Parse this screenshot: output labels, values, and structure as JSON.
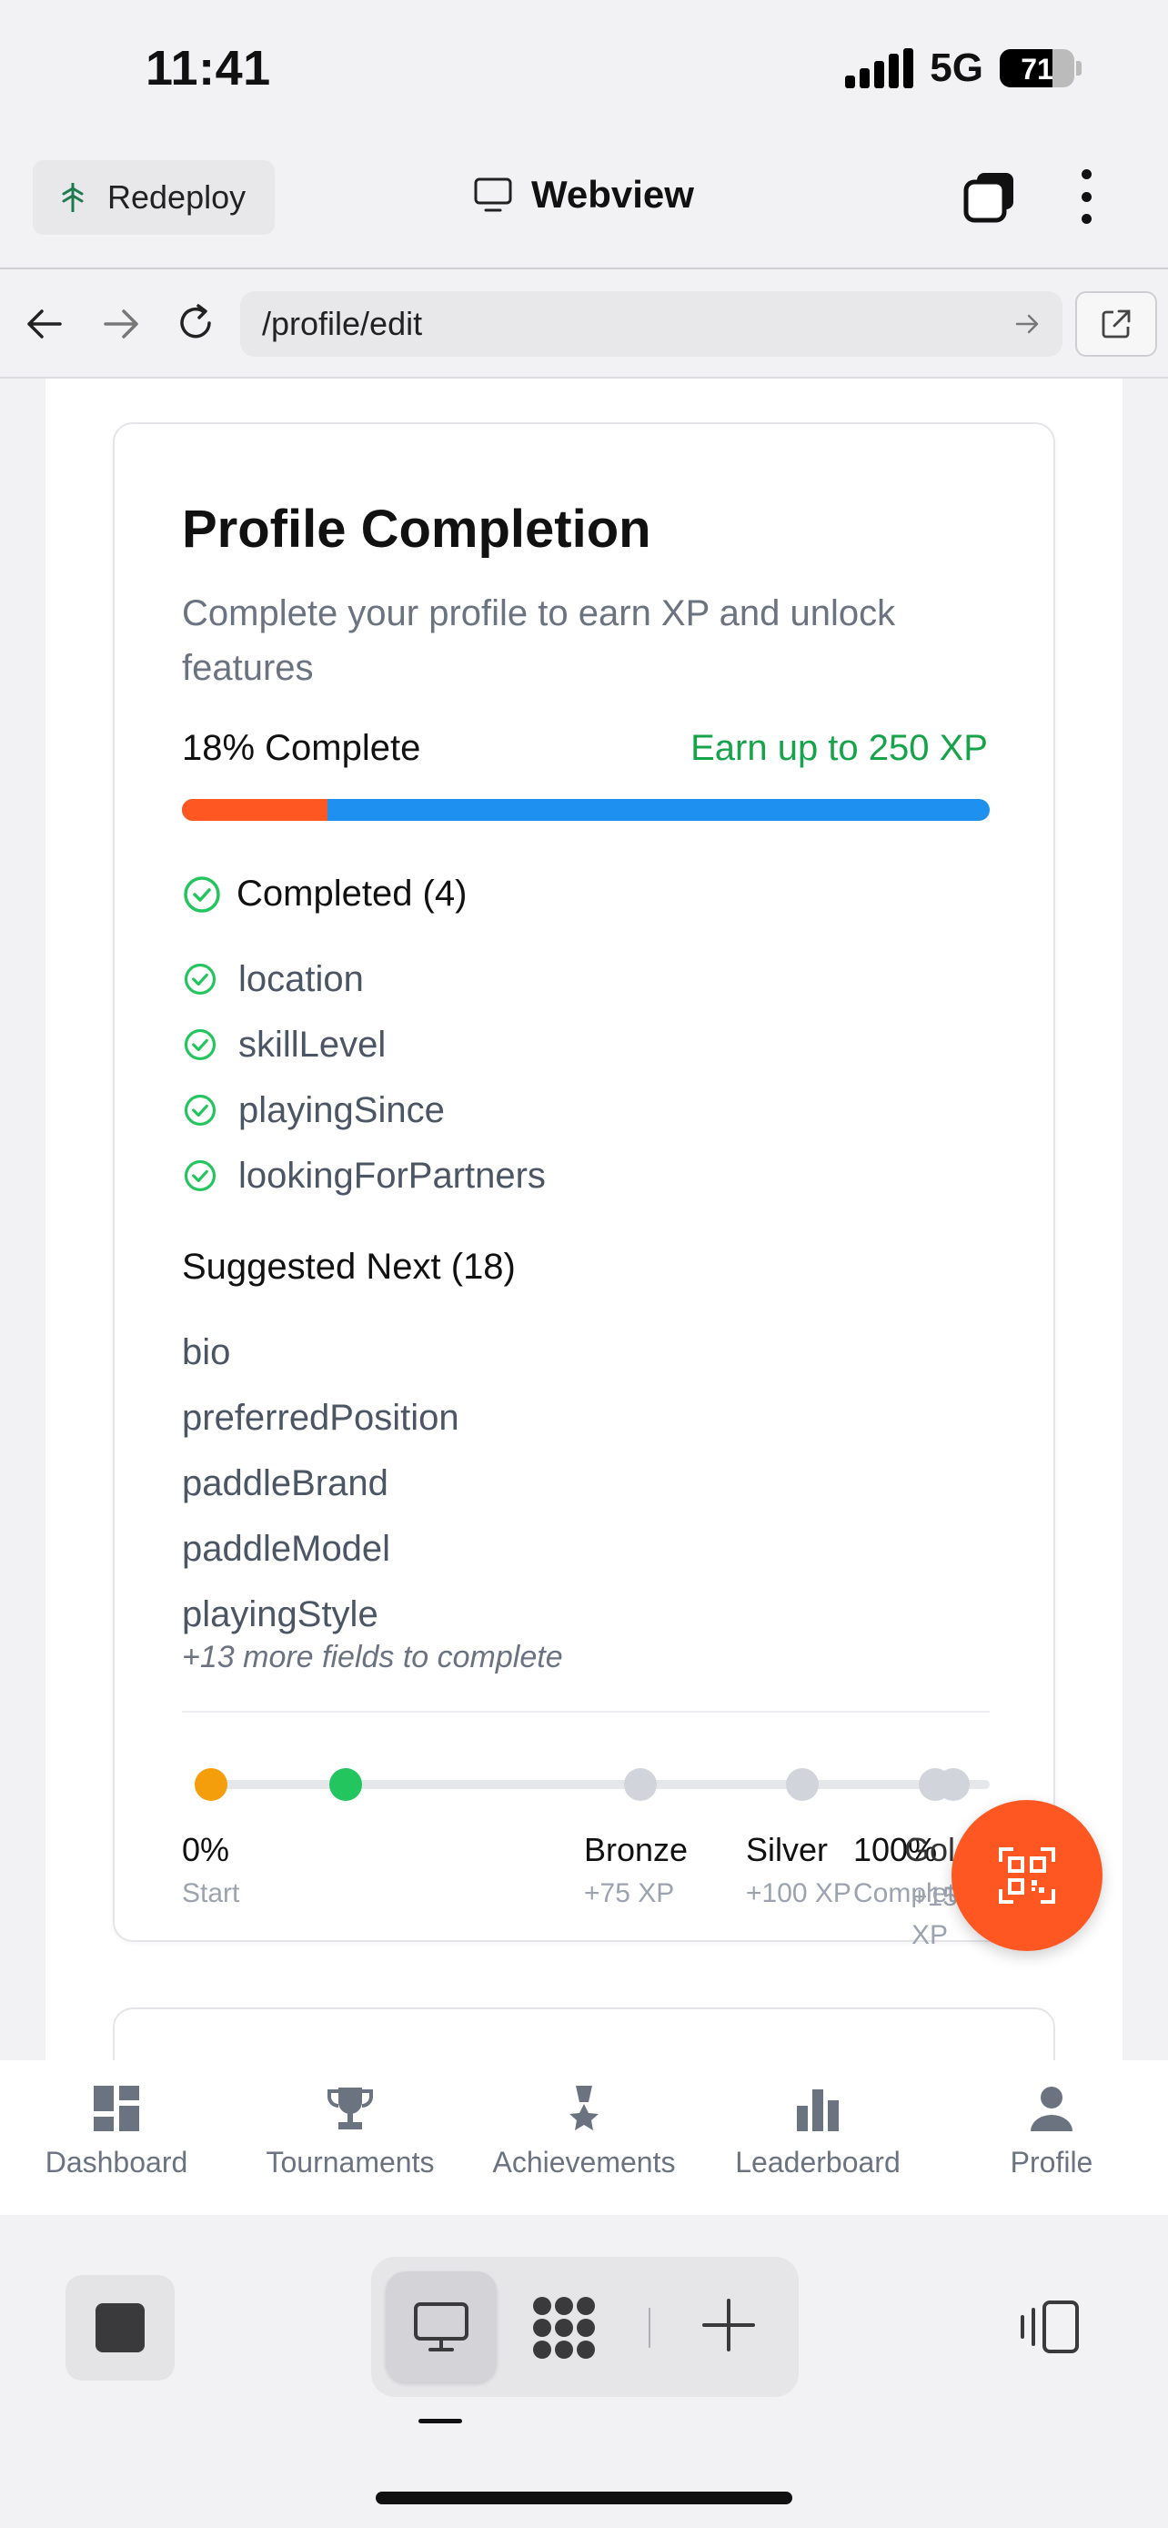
{
  "status_bar": {
    "time": "11:41",
    "network": "5G",
    "battery": "71"
  },
  "webview_header": {
    "redeploy_label": "Redeploy",
    "title": "Webview"
  },
  "url_bar": {
    "url": "/profile/edit"
  },
  "profile_completion": {
    "title": "Profile Completion",
    "subtitle": "Complete your profile to earn XP and unlock features",
    "percent_label": "18% Complete",
    "xp_label": "Earn up to 250 XP",
    "progress": 0.18,
    "completed_heading": "Completed (4)",
    "completed": [
      "location",
      "skillLevel",
      "playingSince",
      "lookingForPartners"
    ],
    "suggested_heading": "Suggested Next (18)",
    "suggested": [
      "bio",
      "preferredPosition",
      "paddleBrand",
      "paddleModel",
      "playingStyle"
    ],
    "more_text": "+13 more fields to complete",
    "milestones": [
      {
        "label": "0%",
        "sub": "Start",
        "color": "#f59e0b"
      },
      {
        "label": "",
        "sub": "",
        "color": "#22c55e"
      },
      {
        "label": "Bronze",
        "sub": "+75 XP",
        "color": "#d1d5db"
      },
      {
        "label": "Silver",
        "sub": "+100 XP",
        "color": "#d1d5db"
      },
      {
        "label": "100%",
        "sub": "Complete",
        "color": "#d1d5db"
      },
      {
        "label": "Gold",
        "sub": "+150 XP",
        "color": "#d1d5db"
      }
    ]
  },
  "tab_bar": {
    "tabs": [
      {
        "label": "Dashboard",
        "icon": "dashboard-icon"
      },
      {
        "label": "Tournaments",
        "icon": "trophy-icon"
      },
      {
        "label": "Achievements",
        "icon": "medal-icon"
      },
      {
        "label": "Leaderboard",
        "icon": "bar-chart-icon"
      },
      {
        "label": "Profile",
        "icon": "person-icon"
      }
    ]
  },
  "colors": {
    "accent_orange": "#ff5722",
    "progress_blue": "#1e90f0",
    "success_green": "#16a34a"
  }
}
